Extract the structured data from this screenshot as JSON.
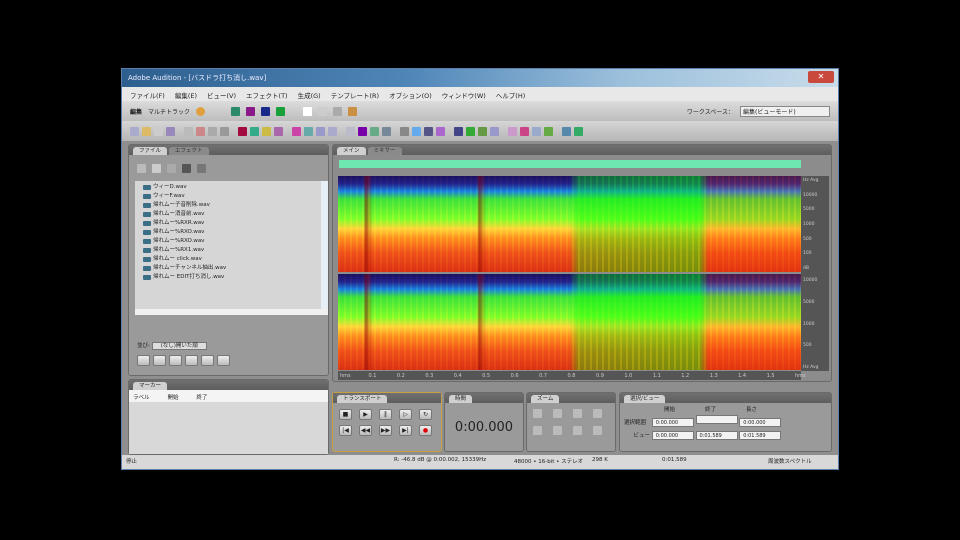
{
  "window": {
    "title": "Adobe Audition - [バスドラ打ち消し.wav]",
    "close": "✕"
  },
  "menu": [
    "ファイル(F)",
    "編集(E)",
    "ビュー(V)",
    "エフェクト(T)",
    "生成(G)",
    "テンプレート(R)",
    "オプション(O)",
    "ウィンドウ(W)",
    "ヘルプ(H)"
  ],
  "toolbar": {
    "edit": "編集",
    "multitrack": "マルチトラック",
    "workspace_label": "ワークスペース：",
    "workspace_value": "編集(ビューモード)"
  },
  "file_panel": {
    "tabs": [
      "ファイル",
      "エフェクト"
    ],
    "files": [
      "ウィーD.wav",
      "ウィーF.wav",
      "帰れムー子音削除.wav",
      "帰れムー消音前.wav",
      "帰れムー%RXR.wav",
      "帰れムー%RXO.wav",
      "帰れムー%RXO.wav",
      "帰れムー%RX1.wav",
      "帰れムー click.wav",
      "帰れムーチャンネル抽出.wav",
      "帰れムー EDIT打ち消し.wav"
    ],
    "sort_label": "並び:",
    "sort_value": "(なし)開いた順"
  },
  "marker_panel": {
    "tab": "マーカー",
    "columns": [
      "ラベル",
      "開始",
      "終了"
    ]
  },
  "editor": {
    "tabs": [
      "メイン",
      "ミキサー"
    ],
    "time_ticks": [
      "hms",
      "0.1",
      "0.2",
      "0.3",
      "0.4",
      "0.5",
      "0.6",
      "0.7",
      "0.8",
      "0.9",
      "1.0",
      "1.1",
      "1.2",
      "1.3",
      "1.4",
      "1.5",
      "hms"
    ],
    "freq_ticks_ch1": [
      "Hz Avg",
      "10000",
      "5000",
      "1000",
      "500",
      "100",
      "dB"
    ],
    "freq_ticks_ch2": [
      "10000",
      "5000",
      "1000",
      "500",
      "Hz Avg"
    ]
  },
  "transport": {
    "tab": "トランスポート"
  },
  "time_panel": {
    "tab": "時間",
    "time": "0:00.000"
  },
  "zoom_panel": {
    "tab": "ズーム"
  },
  "selection_panel": {
    "tab": "選択/ビュー",
    "columns": [
      "開始",
      "終了",
      "長さ"
    ],
    "rows": [
      {
        "label": "選択範囲",
        "values": [
          "0:00.000",
          "",
          "0:00.000"
        ]
      },
      {
        "label": "ビュー",
        "values": [
          "0:00.000",
          "0:01.589",
          "0:01.589"
        ]
      }
    ]
  },
  "status": {
    "left": "停止",
    "level": "R: -46.8 dB @ 0:00.002, 15339Hz",
    "format": "48000 • 16-bit • ステレオ",
    "size": "298 K",
    "duration": "0:01.589",
    "right": "周波数スペクトル"
  }
}
